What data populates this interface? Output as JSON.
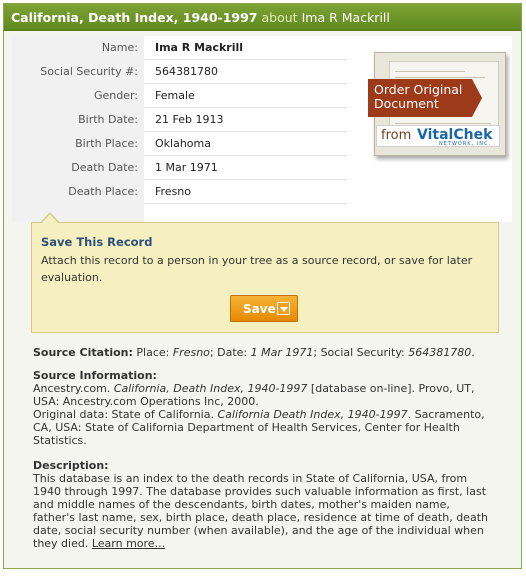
{
  "header": {
    "title": "California, Death Index, 1940-1997",
    "about": "about",
    "person": "Ima R Mackrill"
  },
  "details": [
    {
      "label": "Name:",
      "value": "Ima R Mackrill"
    },
    {
      "label": "Social Security #:",
      "value": "564381780"
    },
    {
      "label": "Gender:",
      "value": "Female"
    },
    {
      "label": "Birth Date:",
      "value": "21 Feb 1913"
    },
    {
      "label": "Birth Place:",
      "value": "Oklahoma"
    },
    {
      "label": "Death Date:",
      "value": "1 Mar 1971"
    },
    {
      "label": "Death Place:",
      "value": "Fresno"
    }
  ],
  "order": {
    "line1": "Order Original",
    "line2": "Document",
    "from": "from",
    "brand": "VitalChek",
    "brand_sub": "NETWORK, INC."
  },
  "save": {
    "heading": "Save This Record",
    "description": "Attach this record to a person in your tree as a source record, or save for later evaluation.",
    "button_label": "Save"
  },
  "citation": {
    "heading": "Source Citation:",
    "place_label": "Place:",
    "place": "Fresno",
    "date_label": "Date:",
    "date": "1 Mar 1971",
    "ss_label": "Social Security:",
    "ss": "564381780"
  },
  "source": {
    "heading": "Source Information:",
    "line1_pre": "Ancestry.com.",
    "line1_title": "California, Death Index, 1940-1997",
    "line1_post": "[database on-line]. Provo, UT, USA: Ancestry.com Operations Inc, 2000.",
    "line2_pre": "Original data: State of California.",
    "line2_title": "California Death Index, 1940-1997",
    "line2_post": ". Sacramento, CA, USA: State of California Department of Health Services, Center for Health Statistics."
  },
  "description": {
    "heading": "Description:",
    "text": "This database is an index to the death records in State of California, USA, from 1940 through 1997. The database provides such valuable information as first, last and middle names of the descendants, birth dates, mother's maiden name, father's last name, sex, birth place, death place, residence at time of death, death date, social security number (when available), and the age of the individual when they died.",
    "learn_more": "Learn more..."
  },
  "colors": {
    "title_bar": "#6d9428",
    "save_box": "#f6f0c0",
    "save_button": "#e68a00",
    "ribbon": "#9c3a1a",
    "heading_blue": "#2f4f7c"
  }
}
